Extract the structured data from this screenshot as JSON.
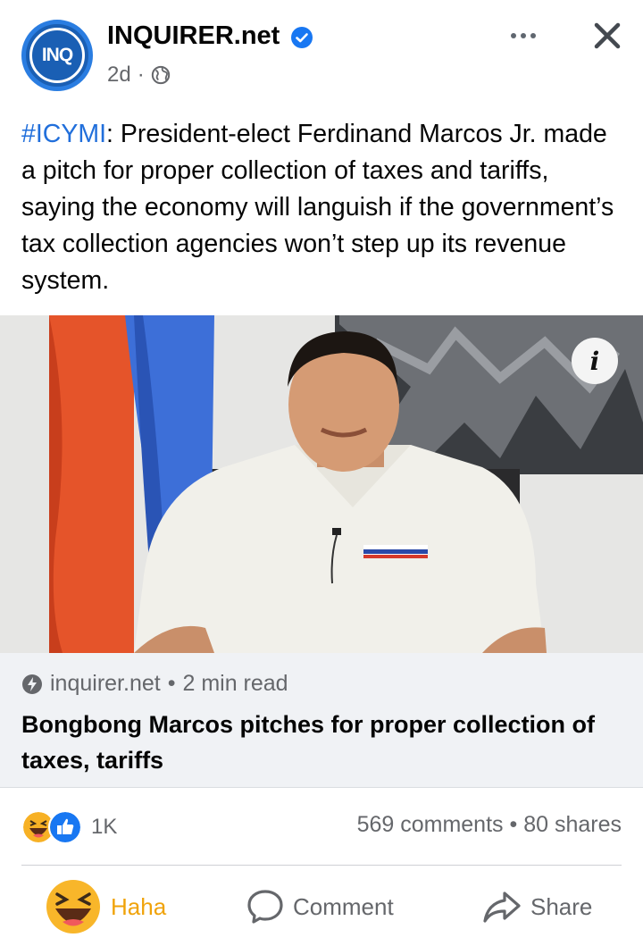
{
  "header": {
    "avatar_text": "INQ",
    "page_name": "INQUIRER.net",
    "time": "2d",
    "separator": "·"
  },
  "post": {
    "hashtag": "#ICYMI",
    "text": ": President-elect Ferdinand Marcos Jr. made a pitch for proper collection of taxes and tariffs, saying the economy will languish if the government’s tax collection agencies won’t step up its revenue system."
  },
  "link": {
    "domain": "inquirer.net",
    "bullet": "•",
    "read_time": "2 min read",
    "headline": "Bongbong Marcos pitches for proper collection of taxes, tariffs",
    "info_label": "i"
  },
  "stats": {
    "reaction_count": "1K",
    "comments": "569 comments",
    "bullet": "•",
    "shares": "80 shares"
  },
  "actions": {
    "haha": "Haha",
    "comment": "Comment",
    "share": "Share"
  },
  "icons": [
    "verified-badge-icon",
    "globe-icon",
    "more-icon",
    "close-icon",
    "info-icon",
    "link-domain-icon",
    "haha-reaction-icon",
    "like-reaction-icon",
    "comment-icon",
    "share-icon"
  ],
  "colors": {
    "accent": "#216fdb",
    "haha": "#f0a30a",
    "muted_text": "#65676b",
    "card_bg": "#f0f2f5"
  }
}
